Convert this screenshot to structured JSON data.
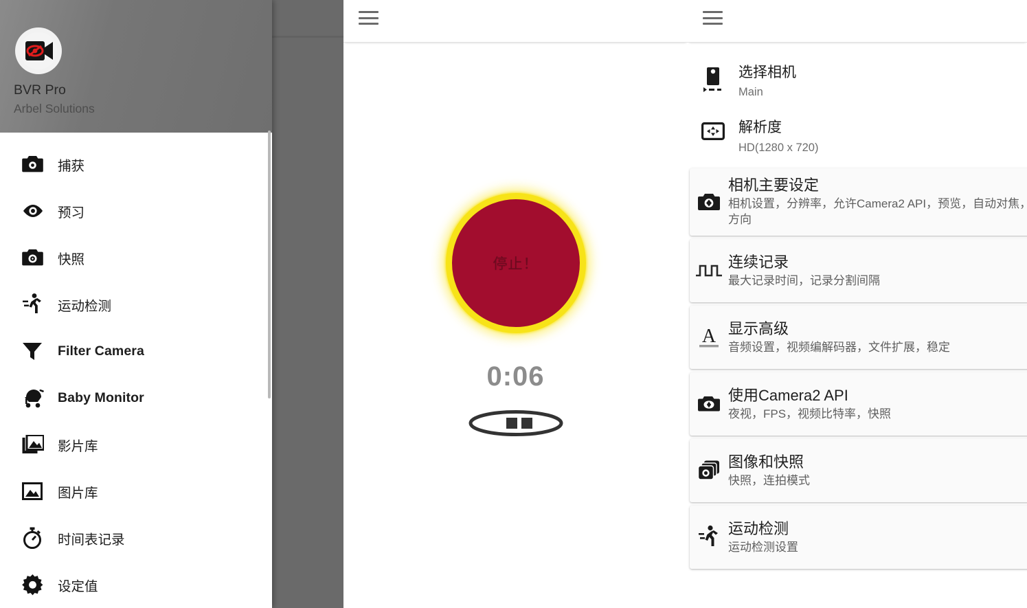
{
  "app": {
    "name": "BVR Pro",
    "vendor": "Arbel Solutions",
    "logo_icon": "video-camera-eye-off-icon"
  },
  "drawer": {
    "scrollbar_name": "drawer-scrollbar",
    "items": [
      {
        "label": "捕获",
        "icon": "camera-icon",
        "bold": false
      },
      {
        "label": "预习",
        "icon": "eye-icon",
        "bold": false
      },
      {
        "label": "快照",
        "icon": "photo-camera-icon",
        "bold": false
      },
      {
        "label": "运动检测",
        "icon": "running-person-icon",
        "bold": false
      },
      {
        "label": "Filter Camera",
        "icon": "filter-funnel-icon",
        "bold": true
      },
      {
        "label": "Baby Monitor",
        "icon": "stroller-icon",
        "bold": true
      },
      {
        "label": "影片库",
        "icon": "video-library-icon",
        "bold": false
      },
      {
        "label": "图片库",
        "icon": "image-library-icon",
        "bold": false
      },
      {
        "label": "时间表记录",
        "icon": "timer-icon",
        "bold": false
      },
      {
        "label": "设定值",
        "icon": "gear-icon",
        "bold": false
      }
    ]
  },
  "center": {
    "menu_icon": "hamburger-icon",
    "stop_button_label": "停止！",
    "timer": "0:06",
    "pause_icon": "pause-oval-icon",
    "colors": {
      "button_fill": "#a20d2e",
      "button_ring": "#f7e318",
      "timer_text": "#8c8c8c"
    }
  },
  "right": {
    "menu_icon": "hamburger-icon",
    "plain_rows": [
      {
        "title": "选择相机",
        "subtitle": "Main",
        "icon": "select-camera-icon"
      },
      {
        "title": "解析度",
        "subtitle": "HD(1280 x 720)",
        "icon": "resolution-icon"
      }
    ],
    "cards": [
      {
        "title": "相机主要设定",
        "subtitle": "相机设置，分辨率，允许Camera2 API，预览，自动对焦，方向",
        "icon": "camera-settings-icon"
      },
      {
        "title": "连续记录",
        "subtitle": "最大记录时间，记录分割间隔",
        "icon": "pulse-wave-icon"
      },
      {
        "title": "显示高级",
        "subtitle": "音频设置，视频编解码器，文件扩展，稳定",
        "icon": "letter-a-icon"
      },
      {
        "title": "使用Camera2 API",
        "subtitle": "夜视，FPS，视频比特率，快照",
        "icon": "camera-api-icon"
      },
      {
        "title": "图像和快照",
        "subtitle": "快照，连拍模式",
        "icon": "burst-photos-icon"
      },
      {
        "title": "运动检测",
        "subtitle": "运动检测设置",
        "icon": "running-person-icon"
      }
    ]
  }
}
